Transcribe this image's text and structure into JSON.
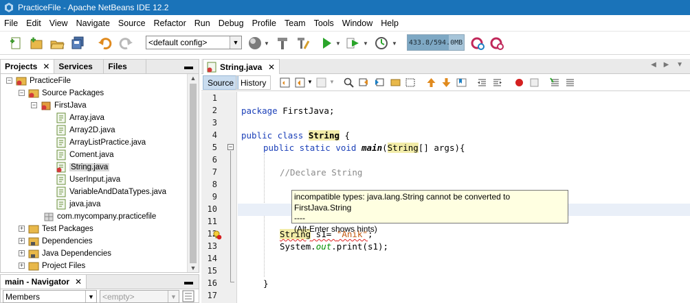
{
  "window": {
    "title": "PracticeFile - Apache NetBeans IDE 12.2"
  },
  "menu": [
    "File",
    "Edit",
    "View",
    "Navigate",
    "Source",
    "Refactor",
    "Run",
    "Debug",
    "Profile",
    "Team",
    "Tools",
    "Window",
    "Help"
  ],
  "toolbar": {
    "config_value": "<default config>",
    "memory_text": "433.8/594.0MB",
    "memory_used_fraction": 0.73
  },
  "projects_panel": {
    "tabs": [
      "Projects",
      "Services",
      "Files"
    ],
    "tree": [
      "PracticeFile",
      "Source Packages",
      "FirstJava",
      "Array.java",
      "Array2D.java",
      "ArrayListPractice.java",
      "Coment.java",
      "String.java",
      "UserInput.java",
      "VariableAndDataTypes.java",
      "java.java",
      "com.mycompany.practicefile",
      "Test Packages",
      "Dependencies",
      "Java Dependencies",
      "Project Files"
    ]
  },
  "navigator_panel": {
    "title": "main - Navigator",
    "members_value": "Members",
    "filter_placeholder": "<empty>"
  },
  "editor": {
    "tab_label": "String.java",
    "source_label": "Source",
    "history_label": "History",
    "line_numbers": [
      "1",
      "2",
      "3",
      "4",
      "5",
      "6",
      "7",
      "8",
      "9",
      "10",
      "11",
      "12",
      "13",
      "14",
      "15",
      "16",
      "17"
    ],
    "code": {
      "l2_kw": "package",
      "l2_rest": " FirstJava;",
      "l4_kw": "public class",
      "l4_sp": " ",
      "l4_name": "String",
      "l4_rest": " {",
      "l5_kw": "public static void",
      "l5_sp": " ",
      "l5_name": "main",
      "l5_p1": "(",
      "l5_type": "String",
      "l5_rest": "[] args){",
      "l7_comment": "//Declare String",
      "l12_type": "String",
      "l12_mid": " s1= ",
      "l12_str": "\"Anik\"",
      "l12_end": ";",
      "l13_a": "System.",
      "l13_out": "out",
      "l13_b": ".print(s1);",
      "l16": "}"
    }
  },
  "tooltip": {
    "line1": "incompatible types: java.lang.String cannot be converted to FirstJava.String",
    "line2": "----",
    "line3": "(Alt-Enter shows hints)"
  }
}
